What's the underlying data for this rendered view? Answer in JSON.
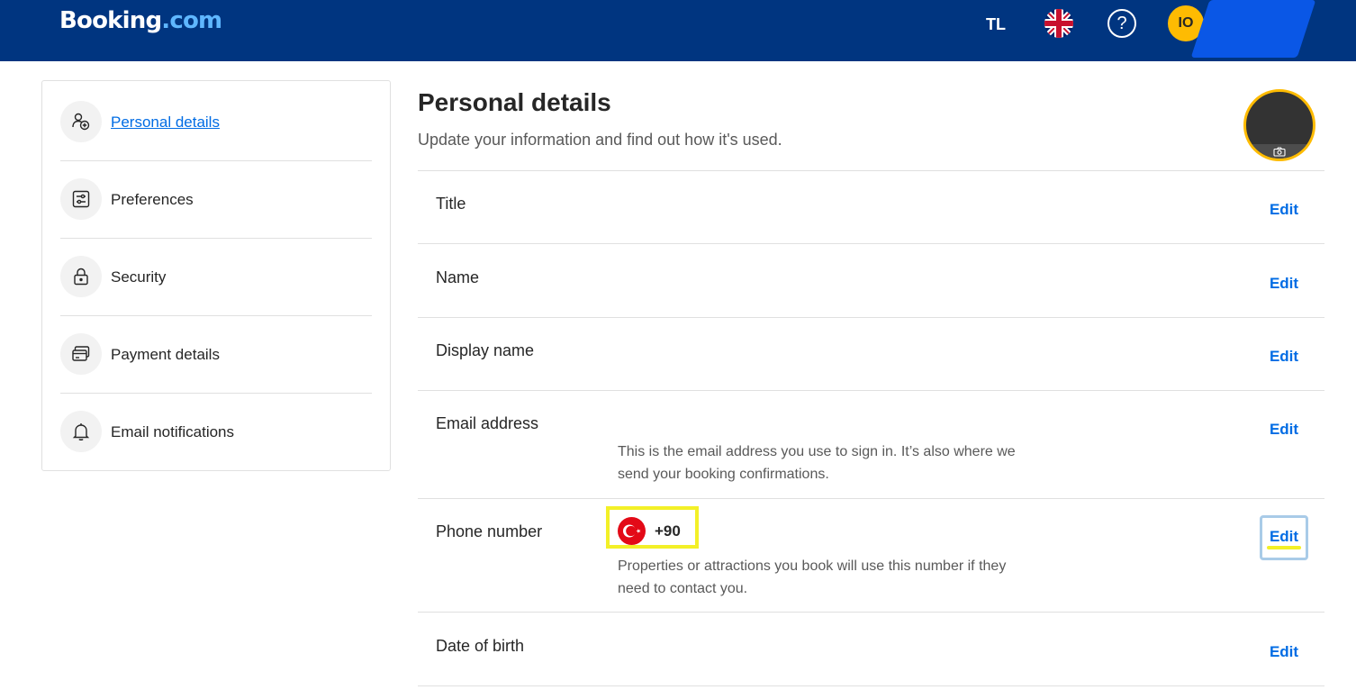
{
  "header": {
    "logo_main": "Booking",
    "logo_dot": ".com",
    "currency": "TL",
    "help_icon": "?",
    "avatar_initials": "IO",
    "brand_color": "#003580",
    "accent_color": "#febb02"
  },
  "sidebar": {
    "items": [
      {
        "label": "Personal details",
        "icon": "person-add-icon",
        "active": true
      },
      {
        "label": "Preferences",
        "icon": "sliders-icon",
        "active": false
      },
      {
        "label": "Security",
        "icon": "lock-icon",
        "active": false
      },
      {
        "label": "Payment details",
        "icon": "card-icon",
        "active": false
      },
      {
        "label": "Email notifications",
        "icon": "bell-icon",
        "active": false
      }
    ]
  },
  "main": {
    "title": "Personal details",
    "subtitle": "Update your information and find out how it's used.",
    "edit_label": "Edit",
    "rows": [
      {
        "label": "Title"
      },
      {
        "label": "Name"
      },
      {
        "label": "Display name"
      },
      {
        "label": "Email address",
        "note": "This is the email address you use to sign in. It’s also where we send your booking confirmations."
      },
      {
        "label": "Phone number",
        "country_code": "+90",
        "note": "Properties or attractions you book will use this number if they need to contact you."
      },
      {
        "label": "Date of birth"
      }
    ]
  }
}
